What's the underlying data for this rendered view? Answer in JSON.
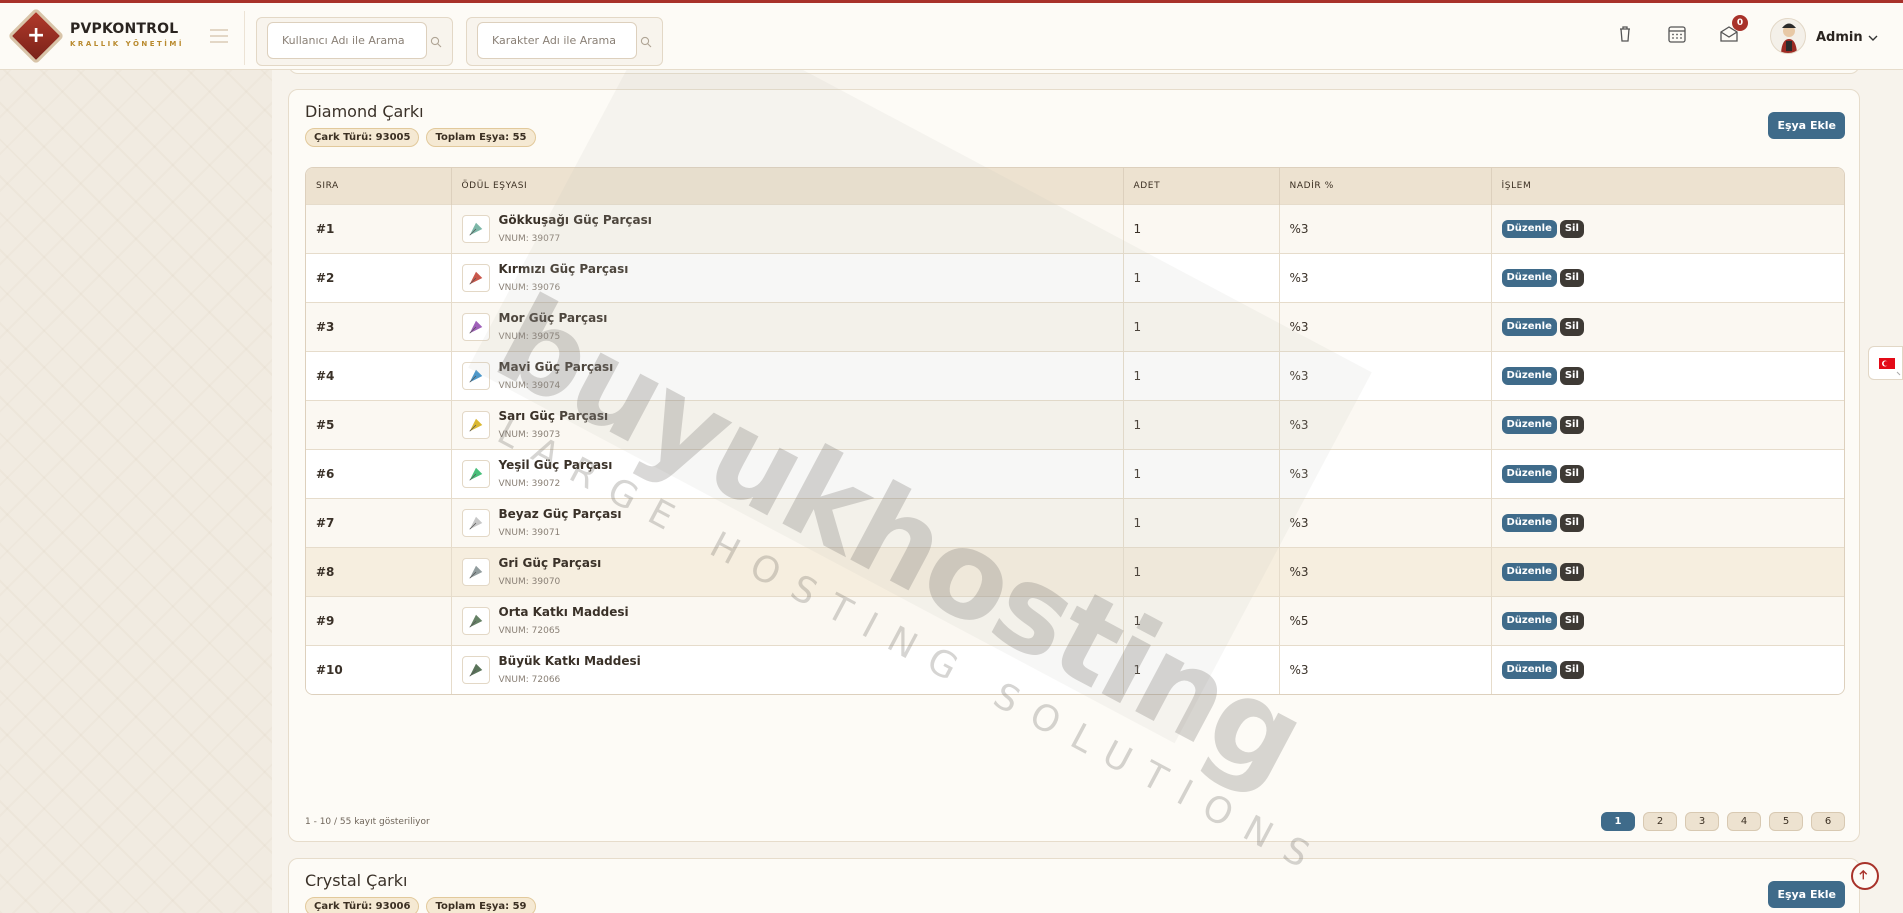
{
  "app": {
    "brand_title": "PVPKONTROL",
    "brand_subtitle": "KRALLIK YÖNETİMİ"
  },
  "header": {
    "search_user_placeholder": "Kullanıcı Adı ile Arama",
    "search_char_placeholder": "Karakter Adı ile Arama",
    "mail_count": "0",
    "user_name": "Admin"
  },
  "cards": [
    {
      "title": "Diamond Çarkı",
      "wheel_type": "Çark Türü: 93005",
      "total_items": "Toplam Eşya: 55",
      "add_button": "Eşya Ekle",
      "columns": [
        "SIRA",
        "ÖDÜL EŞYASI",
        "ADET",
        "NADİR %",
        "İŞLEM"
      ],
      "rows": [
        {
          "rank": "#1",
          "name": "Gökkuşağı Güç Parçası",
          "vnum": "VNUM: 39077",
          "qty": "1",
          "rare": "%3",
          "color": "#6a9"
        },
        {
          "rank": "#2",
          "name": "Kırmızı Güç Parçası",
          "vnum": "VNUM: 39076",
          "qty": "1",
          "rare": "%3",
          "color": "#c0392b"
        },
        {
          "rank": "#3",
          "name": "Mor Güç Parçası",
          "vnum": "VNUM: 39075",
          "qty": "1",
          "rare": "%3",
          "color": "#8e44ad"
        },
        {
          "rank": "#4",
          "name": "Mavi Güç Parçası",
          "vnum": "VNUM: 39074",
          "qty": "1",
          "rare": "%3",
          "color": "#2e86c1"
        },
        {
          "rank": "#5",
          "name": "Sarı Güç Parçası",
          "vnum": "VNUM: 39073",
          "qty": "1",
          "rare": "%3",
          "color": "#d4ac0d"
        },
        {
          "rank": "#6",
          "name": "Yeşil Güç Parçası",
          "vnum": "VNUM: 39072",
          "qty": "1",
          "rare": "%3",
          "color": "#28b463"
        },
        {
          "rank": "#7",
          "name": "Beyaz Güç Parçası",
          "vnum": "VNUM: 39071",
          "qty": "1",
          "rare": "%3",
          "color": "#bdbdbd"
        },
        {
          "rank": "#8",
          "name": "Gri Güç Parçası",
          "vnum": "VNUM: 39070",
          "qty": "1",
          "rare": "%3",
          "color": "#7f8c8d"
        },
        {
          "rank": "#9",
          "name": "Orta Katkı Maddesi",
          "vnum": "VNUM: 72065",
          "qty": "1",
          "rare": "%5",
          "color": "#4a6b4a"
        },
        {
          "rank": "#10",
          "name": "Büyük Katkı Maddesi",
          "vnum": "VNUM: 72066",
          "qty": "1",
          "rare": "%3",
          "color": "#3d5c3d"
        }
      ],
      "edit_label": "Düzenle",
      "delete_label": "Sil",
      "footer_info": "1 - 10 / 55 kayıt gösteriliyor",
      "pages": [
        "1",
        "2",
        "3",
        "4",
        "5",
        "6"
      ]
    },
    {
      "title": "Crystal Çarkı",
      "wheel_type": "Çark Türü: 93006",
      "total_items": "Toplam Eşya: 59",
      "add_button": "Eşya Ekle"
    }
  ],
  "watermark": {
    "big": "buyukhosting",
    "small": "LARGE HOSTING SOLUTIONS"
  },
  "colors": {
    "accent": "#a8322a",
    "primary_button": "#3f6b8a",
    "delete_button": "#3e3a35"
  }
}
